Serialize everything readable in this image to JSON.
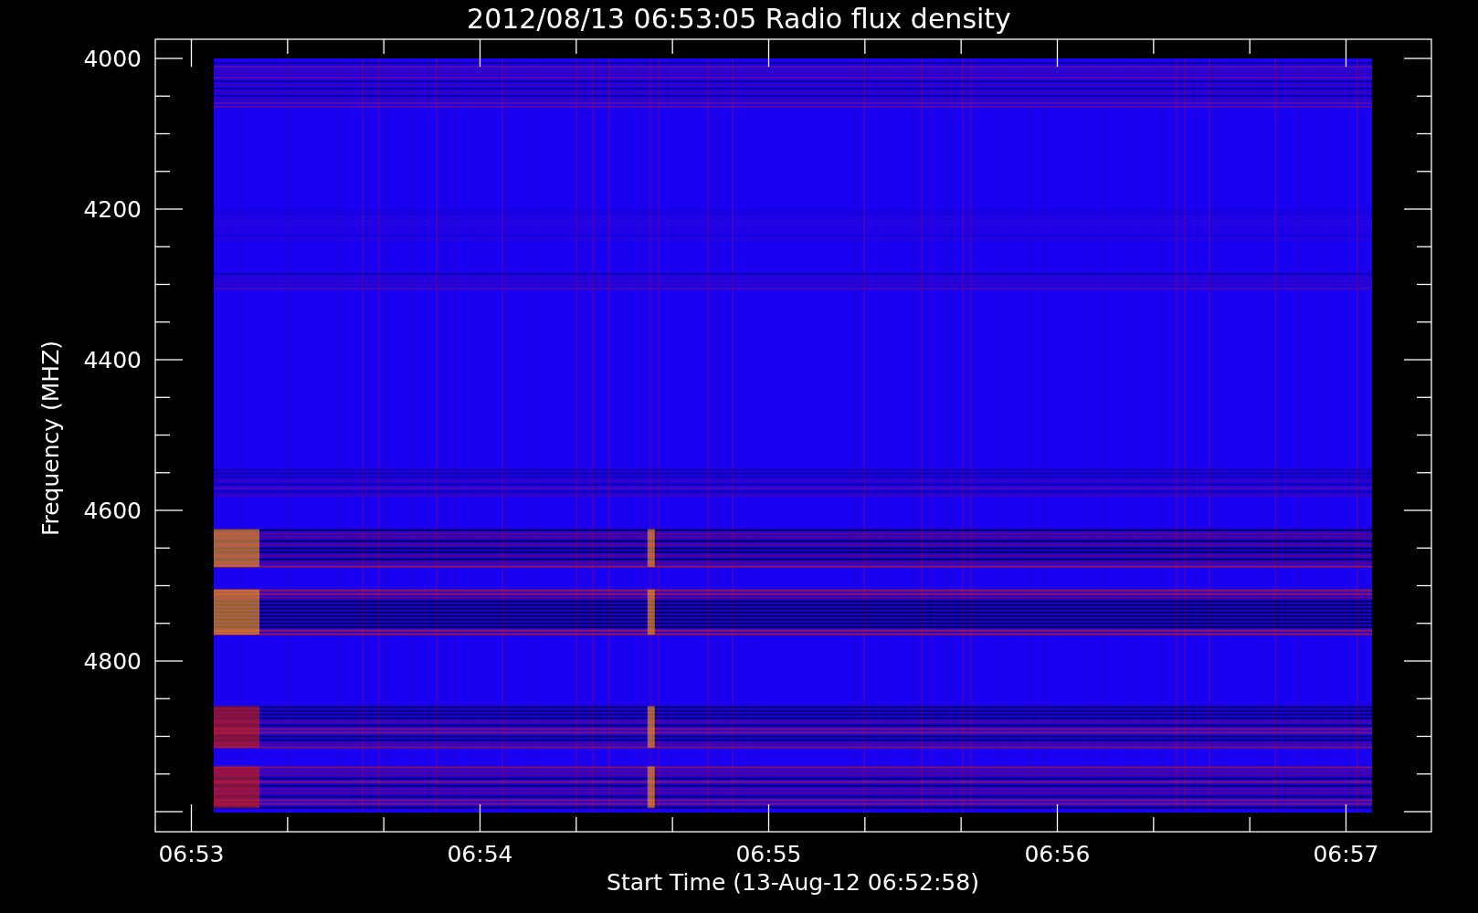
{
  "title": "2012/08/13 06:53:05 Radio flux density",
  "y_axis": {
    "label": "Frequency (MHZ)",
    "ticks": [
      "4000",
      "4200",
      "4400",
      "4600",
      "4800"
    ]
  },
  "x_axis": {
    "label": "Start Time (13-Aug-12 06:52:58)",
    "ticks": [
      "06:53",
      "06:54",
      "06:55",
      "06:56",
      "06:57"
    ]
  }
}
